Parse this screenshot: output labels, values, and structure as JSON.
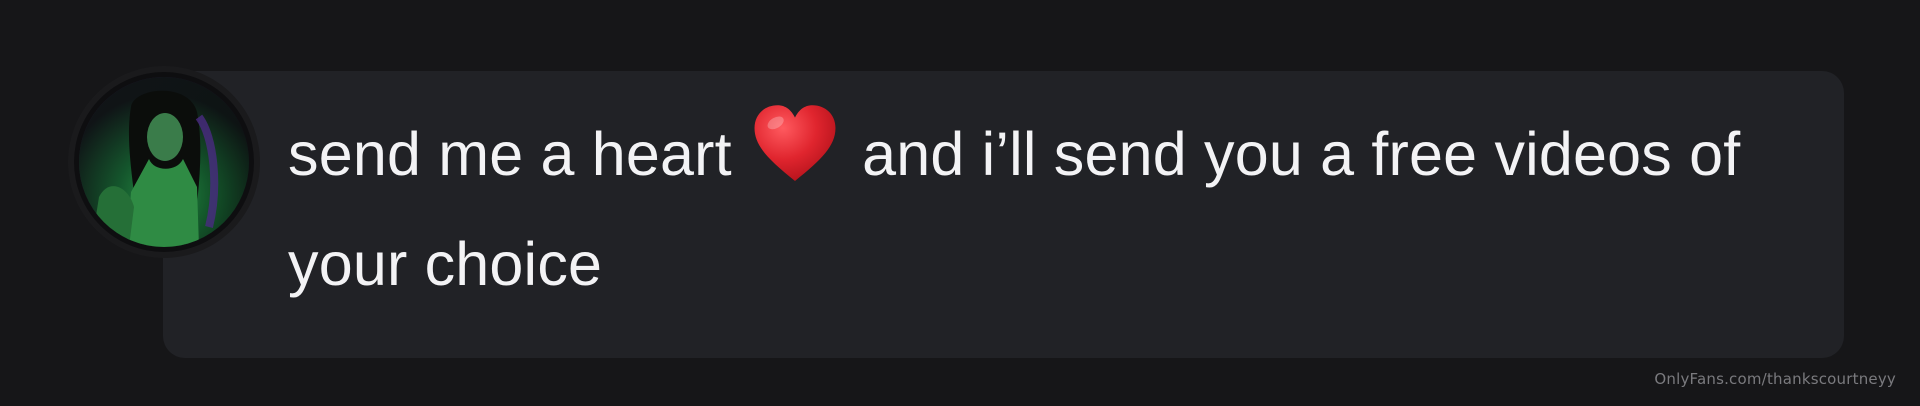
{
  "message": {
    "text_before_icon": "send me a heart ",
    "icon": "red-heart-icon",
    "text_after_icon": " and i’ll send you a free videos of your choice"
  },
  "watermark": {
    "text": "OnlyFans.com/thankscourtneyy"
  },
  "colors": {
    "background": "#161618",
    "bubble": "#212226",
    "text": "#f3f3f5",
    "heart": "#e0252e"
  }
}
